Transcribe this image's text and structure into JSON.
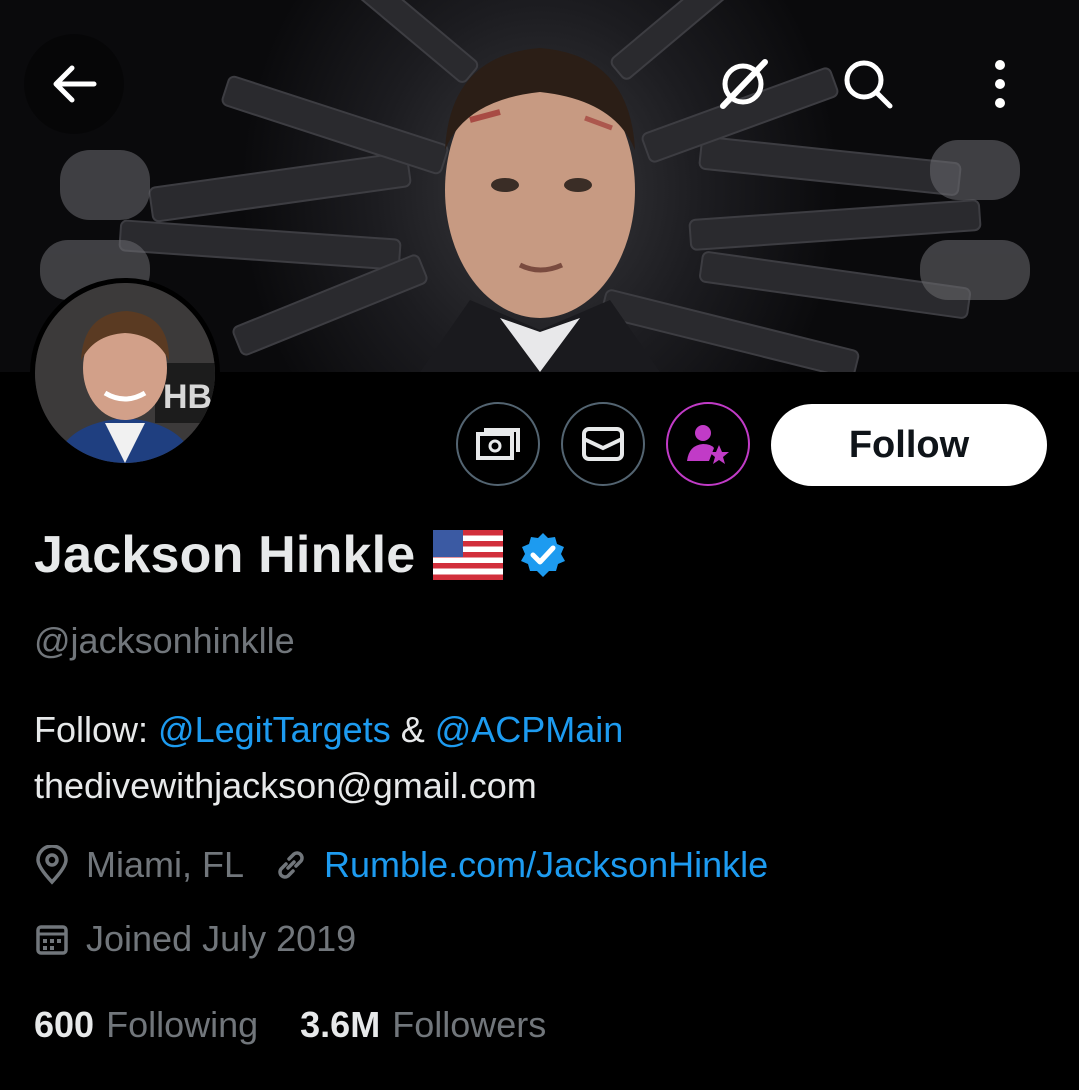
{
  "header": {
    "icons": [
      "back-arrow-icon",
      "grok-icon",
      "search-icon",
      "more-vertical-icon"
    ]
  },
  "profile": {
    "display_name": "Jackson Hinkle",
    "flag": "us-flag",
    "verified": true,
    "handle": "@jacksonhinklle",
    "follow_label": "Follow",
    "action_icons": [
      "tip-money-icon",
      "message-icon",
      "subscribe-icon"
    ],
    "bio": {
      "line1_prefix": "Follow: ",
      "mention1": "@LegitTargets",
      "connector": " & ",
      "mention2": "@ACPMain",
      "line2": "thedivewithjackson@gmail.com"
    },
    "location": "Miami, FL",
    "website": "Rumble.com/JacksonHinkle",
    "joined": "Joined July 2019",
    "following_count": "600",
    "following_label": "Following",
    "followers_count": "3.6M",
    "followers_label": "Followers"
  },
  "colors": {
    "background": "#000000",
    "link": "#1d9bf0",
    "muted": "#71767b",
    "verified": "#1d9bf0",
    "subscribe": "#c13bc7"
  }
}
